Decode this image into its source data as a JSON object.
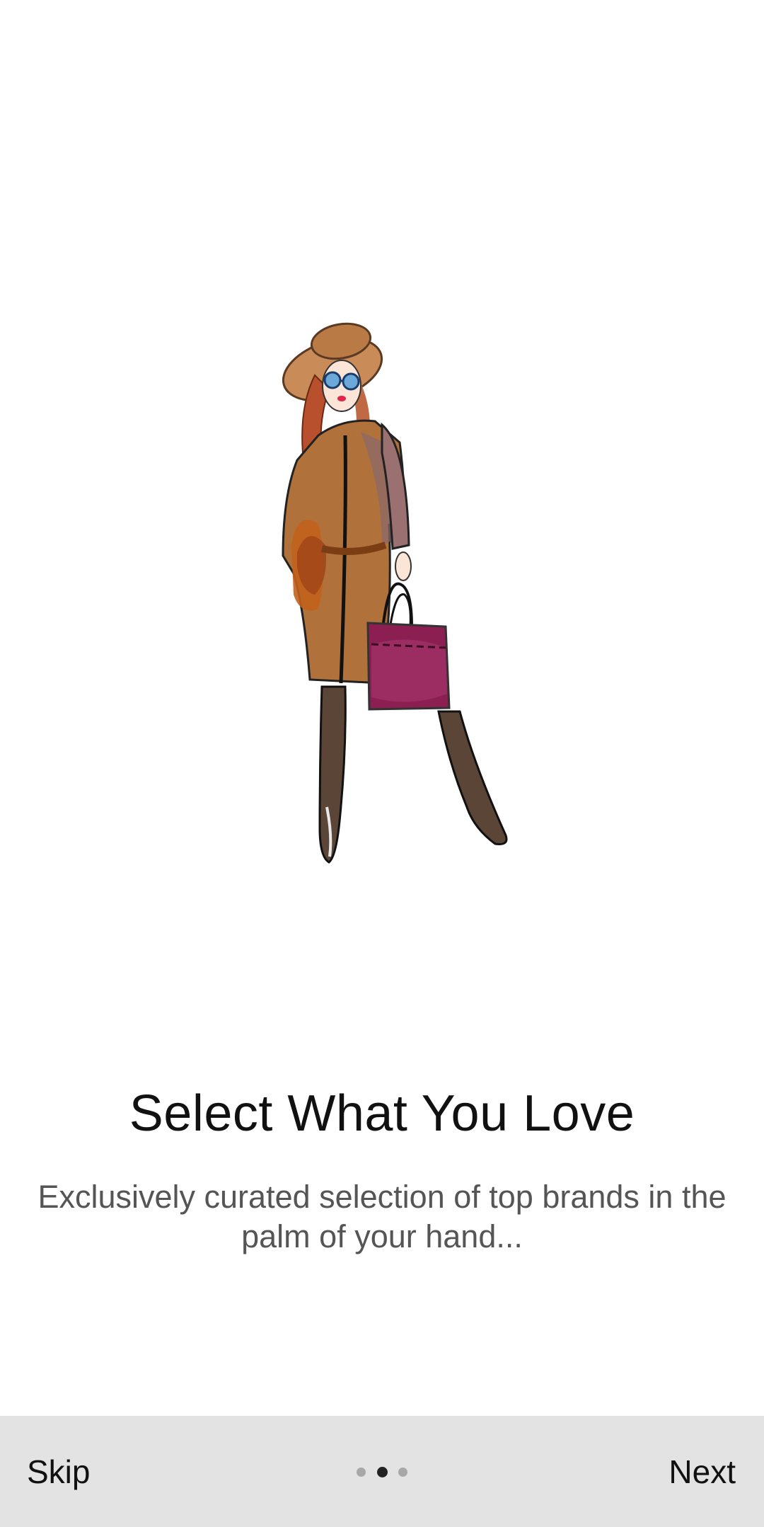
{
  "onboarding": {
    "title": "Select What You Love",
    "subtitle": "Exclusively curated selection of top brands in the palm of your hand...",
    "illustration": "fashion-woman-illustration",
    "page_indicator": {
      "total": 3,
      "current": 2
    }
  },
  "footer": {
    "skip_label": "Skip",
    "next_label": "Next",
    "background": "#e3e3e3"
  },
  "colors": {
    "coat": "#b0713a",
    "bag": "#8b1f52",
    "hair": "#b9502d",
    "hat": "#c98b57"
  }
}
